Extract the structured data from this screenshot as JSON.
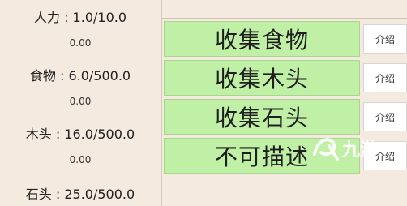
{
  "resources": [
    {
      "label": "人力 : 1.0/10.0",
      "rate": "0.00"
    },
    {
      "label": "食物 : 6.0/500.0",
      "rate": "0.00"
    },
    {
      "label": "木头 : 16.0/500.0",
      "rate": "0.00"
    },
    {
      "label": "石头 : 25.0/500.0"
    }
  ],
  "actions": [
    {
      "label": "收集食物",
      "info": "介绍"
    },
    {
      "label": "收集木头",
      "info": "介绍"
    },
    {
      "label": "收集石头",
      "info": "介绍"
    },
    {
      "label": "不可描述",
      "info": "介绍"
    }
  ],
  "watermark": {
    "text": "九游"
  },
  "colors": {
    "action_bg": "#bff0a6",
    "page_bg": "#f4eadf"
  }
}
